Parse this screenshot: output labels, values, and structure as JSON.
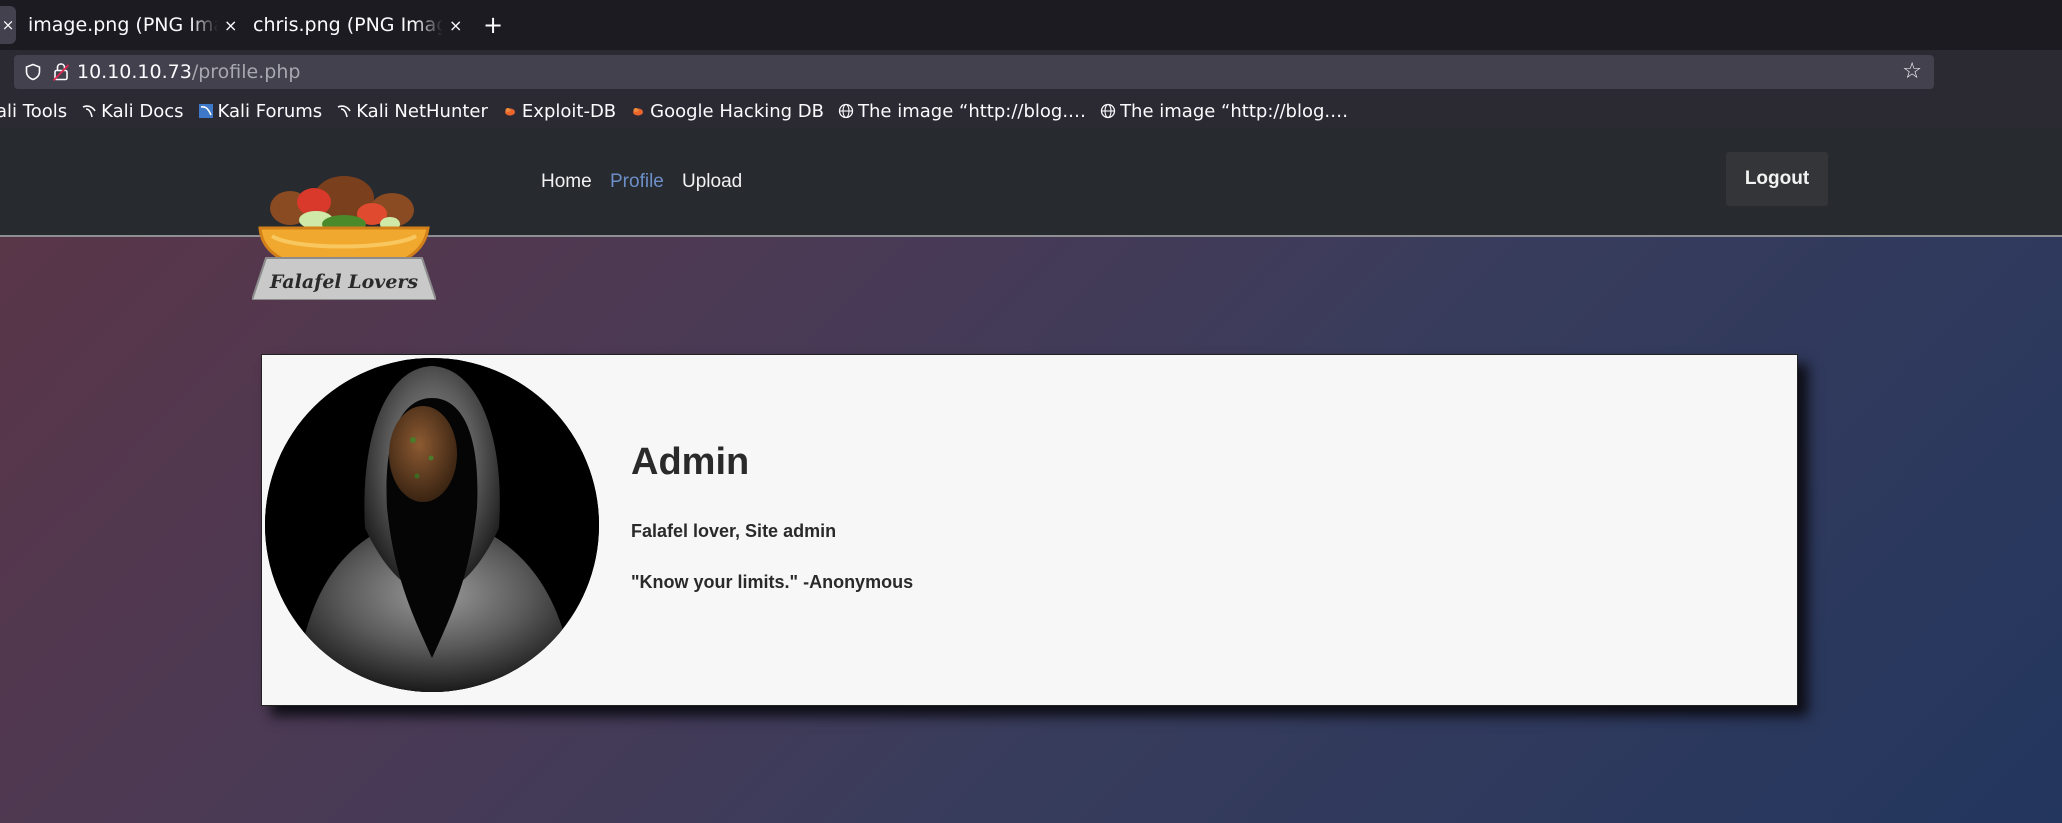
{
  "browser": {
    "tabs": [
      {
        "title": "image.png (PNG Imag",
        "close": "×"
      },
      {
        "title": "chris.png (PNG Image,",
        "close": "×"
      }
    ],
    "edge_tab_close": "×",
    "new_tab": "+",
    "url_host": "10.10.10.73",
    "url_path": "/profile.php",
    "bookmarks": [
      {
        "label": "ali Tools",
        "icon": "none"
      },
      {
        "label": "Kali Docs",
        "icon": "kali-dragon-icon"
      },
      {
        "label": "Kali Forums",
        "icon": "kali-forums-icon"
      },
      {
        "label": "Kali NetHunter",
        "icon": "kali-dragon-icon"
      },
      {
        "label": "Exploit-DB",
        "icon": "exploit-db-icon"
      },
      {
        "label": "Google Hacking DB",
        "icon": "exploit-db-icon"
      },
      {
        "label": "The image “http://blog.…",
        "icon": "globe-icon"
      },
      {
        "label": "The image “http://blog.…",
        "icon": "globe-icon"
      }
    ]
  },
  "site": {
    "logo_text": "Falafel Lovers",
    "nav": [
      {
        "label": "Home",
        "active": false
      },
      {
        "label": "Profile",
        "active": true
      },
      {
        "label": "Upload",
        "active": false
      }
    ],
    "logout_label": "Logout"
  },
  "profile": {
    "name": "Admin",
    "bio": "Falafel lover, Site admin",
    "quote": "\"Know your limits.\" -Anonymous"
  },
  "colors": {
    "active_nav": "#6d8fc8",
    "header_bg": "#272a2f",
    "card_bg": "#f7f7f7"
  }
}
